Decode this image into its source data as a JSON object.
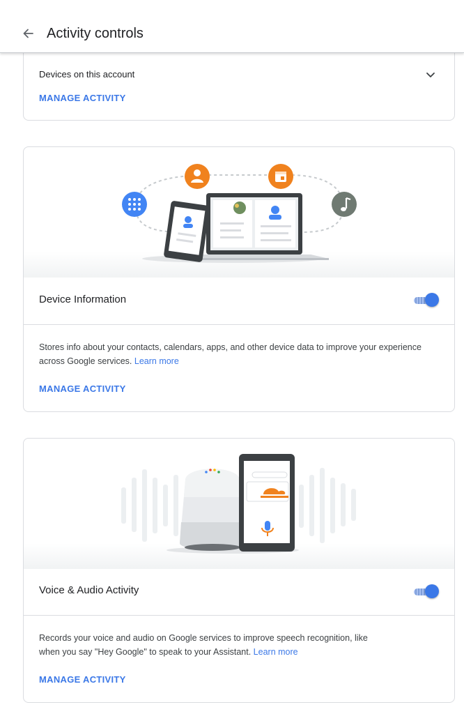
{
  "header": {
    "title": "Activity controls"
  },
  "devices_card": {
    "label": "Devices on this account",
    "manage_label": "MANAGE ACTIVITY"
  },
  "device_info": {
    "title": "Device Information",
    "toggle_on": true,
    "description": "Stores info about your contacts, calendars, apps, and other device data to improve your experience across Google services.",
    "learn_more": "Learn more",
    "manage_label": "MANAGE ACTIVITY"
  },
  "voice_audio": {
    "title": "Voice & Audio Activity",
    "toggle_on": true,
    "description_line1": "Records your voice and audio on Google services to improve speech recognition, like",
    "description_line2": "when you say \"Hey Google\" to speak to your Assistant.",
    "learn_more": "Learn more",
    "manage_label": "MANAGE ACTIVITY"
  },
  "colors": {
    "accent": "#3b78e7",
    "orange": "#f0821e",
    "gray_icon": "#6f7a72"
  }
}
